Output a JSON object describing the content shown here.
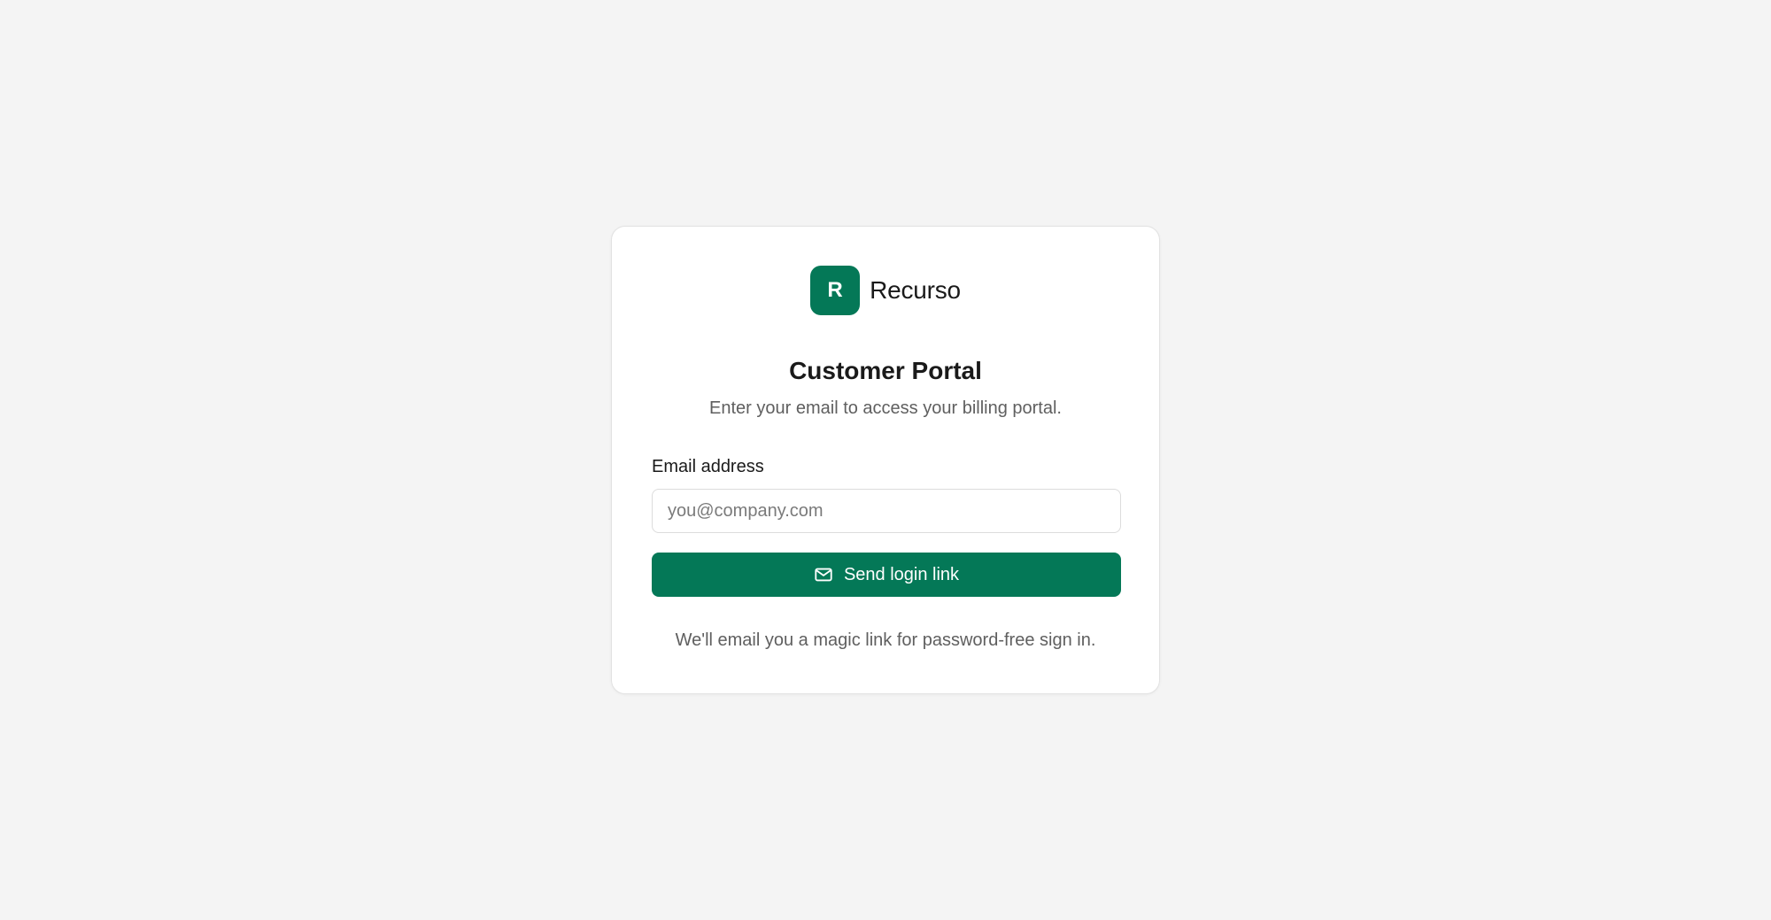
{
  "colors": {
    "accent": "#047857",
    "page_background": "#f4f4f4",
    "card_background": "#ffffff"
  },
  "brand": {
    "mark_letter": "R",
    "name": "Recurso"
  },
  "header": {
    "title": "Customer Portal",
    "subtitle": "Enter your email to access your billing portal."
  },
  "form": {
    "email_label": "Email address",
    "email_placeholder": "you@company.com",
    "email_value": "",
    "submit_label": "Send login link",
    "submit_icon": "mail-icon"
  },
  "footer": {
    "helper_text": "We'll email you a magic link for password-free sign in."
  }
}
